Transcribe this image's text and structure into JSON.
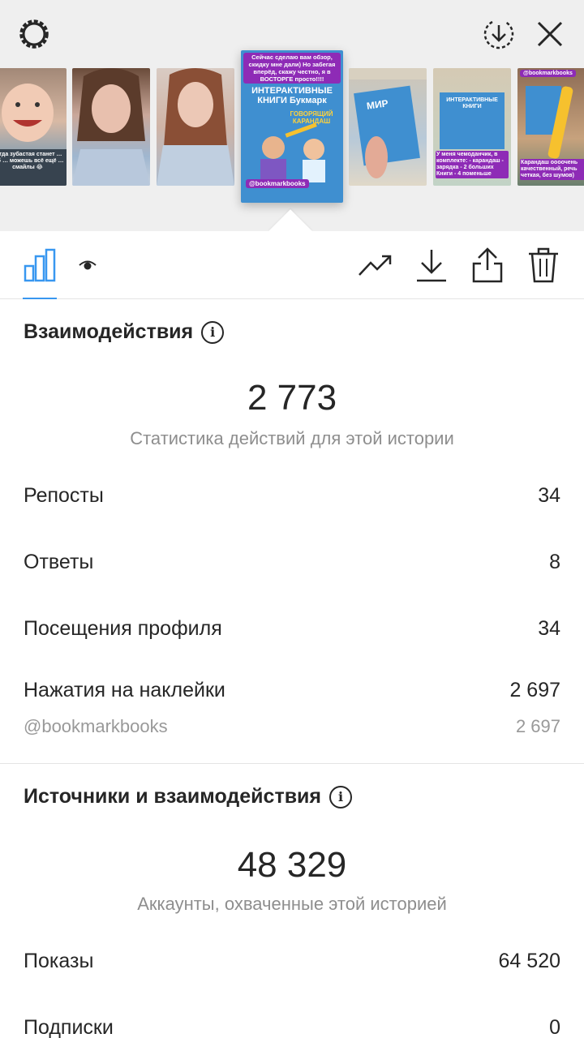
{
  "top_bar": {
    "settings_icon": "settings-ring-icon",
    "download_icon": "download-circle-icon",
    "close_icon": "close-icon"
  },
  "stories": [
    {
      "caption": "когда зубастая станет … зуб … можешь всё ещё … смайлы 😂",
      "active": false
    },
    {
      "caption": "",
      "active": false
    },
    {
      "caption": "",
      "active": false
    },
    {
      "caption": "Сейчас сделаю вам обзор, скидку мне дали) Но забегая вперёд, скажу честно, я в ВОСТОРГЕ просто!!!!",
      "book_title": "ИНТЕРАКТИВНЫЕ КНИГИ Букмарк",
      "book_sub": "ГОВОРЯЩИЙ КАРАНДАШ",
      "tag": "@bookmarkbooks",
      "active": true
    },
    {
      "caption": "",
      "book_title": "МИР",
      "active": false
    },
    {
      "caption": "У меня чемоданчик, в комплекте: - карандаш - зарядка - 2 больших Книги - 4 поменьше",
      "book_title": "ИНТЕРАКТИВНЫЕ КНИГИ",
      "active": false
    },
    {
      "caption": "Карандаш оооочень качественный, речь четкая, без шумов)",
      "tag": "@bookmarkbooks",
      "active": false
    }
  ],
  "toolbar": {
    "insights_icon": "bar-chart-icon",
    "viewers_icon": "eye-icon",
    "promote_icon": "trending-arrow-icon",
    "save_icon": "download-icon",
    "share_icon": "share-icon",
    "delete_icon": "trash-icon"
  },
  "interactions": {
    "title": "Взаимодействия",
    "total": "2 773",
    "total_label": "Статистика действий для этой истории",
    "rows": [
      {
        "label": "Репосты",
        "value": "34"
      },
      {
        "label": "Ответы",
        "value": "8"
      },
      {
        "label": "Посещения профиля",
        "value": "34"
      },
      {
        "label": "Нажатия на наклейки",
        "value": "2 697"
      }
    ],
    "sticker": {
      "label": "@bookmarkbooks",
      "value": "2 697"
    }
  },
  "discovery": {
    "title": "Источники и взаимодействия",
    "total": "48 329",
    "total_label": "Аккаунты, охваченные этой историей",
    "rows": [
      {
        "label": "Показы",
        "value": "64 520"
      },
      {
        "label": "Подписки",
        "value": "0"
      }
    ]
  },
  "colors": {
    "accent": "#3897f0",
    "tag": "#8e2bb6",
    "text": "#262626",
    "muted": "#8e8e8e"
  }
}
